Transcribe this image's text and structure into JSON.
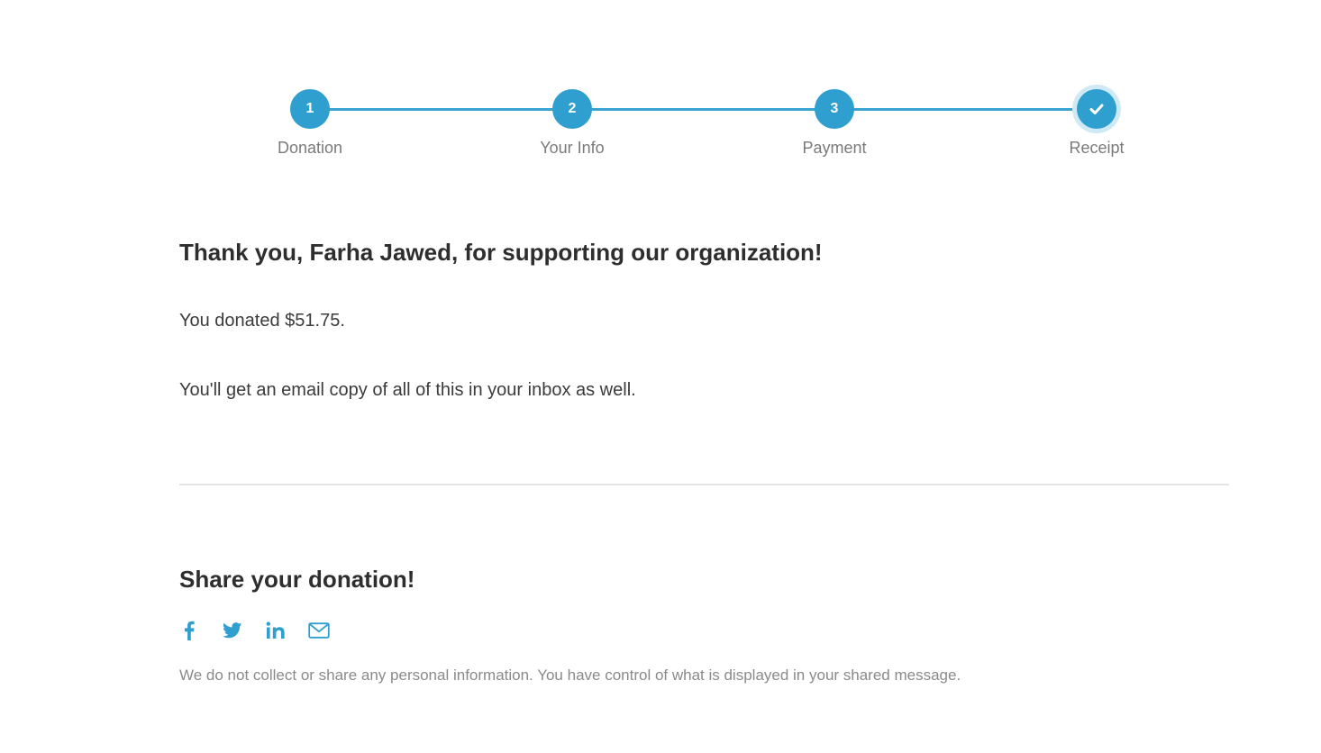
{
  "stepper": {
    "steps": [
      {
        "number": "1",
        "label": "Donation",
        "status": "complete"
      },
      {
        "number": "2",
        "label": "Your Info",
        "status": "complete"
      },
      {
        "number": "3",
        "label": "Payment",
        "status": "complete"
      },
      {
        "number": "",
        "label": "Receipt",
        "status": "current",
        "icon": "checkmark-icon"
      }
    ],
    "accent_color": "#2f9fd0"
  },
  "receipt": {
    "title": "Thank you, Farha Jawed, for supporting our organization!",
    "amount_text": "You donated $51.75.",
    "email_note": "You'll get an email copy of all of this in your inbox as well."
  },
  "share": {
    "title": "Share your donation!",
    "icons": [
      "facebook-icon",
      "twitter-icon",
      "linkedin-icon",
      "email-icon"
    ],
    "privacy_note": "We do not collect or share any personal information. You have control of what is displayed in your shared message."
  }
}
